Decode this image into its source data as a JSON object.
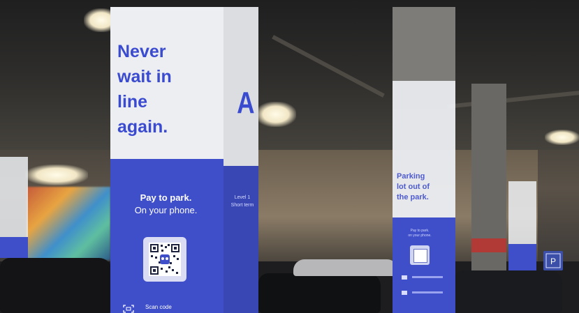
{
  "main_pillar": {
    "headline_lines": [
      "Never",
      "wait in",
      "line",
      "again."
    ],
    "side_letter": "A",
    "pay_title": "Pay to park.",
    "pay_subtitle": "On your phone.",
    "level_lines": [
      "Level 1",
      "Short term"
    ],
    "scan_label": "Scan code"
  },
  "right_pillar": {
    "headline_lines": [
      "Parking",
      "lot out of",
      "the park."
    ],
    "small_lines": [
      "Pay to park.",
      "on your phone."
    ]
  },
  "colors": {
    "brand_blue": "#3f4fc9",
    "sign_white": "#eceef2",
    "headline_blue": "#3b4bd0"
  },
  "icons": [
    "qr-code-icon",
    "scan-code-icon",
    "parking-sign-icon"
  ]
}
